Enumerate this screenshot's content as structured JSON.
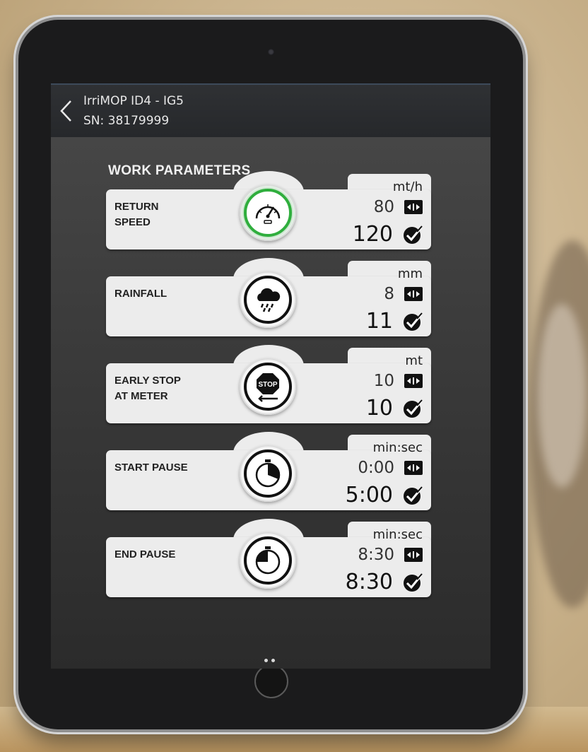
{
  "header": {
    "device_name": "IrriMOP ID4 - IG5",
    "serial": "SN: 38179999"
  },
  "section_title": "WORK PARAMETERS",
  "params": [
    {
      "label": "RETURN\nSPEED",
      "unit": "mt/h",
      "current": "80",
      "set": "120",
      "icon": "speedometer-icon",
      "active": true
    },
    {
      "label": "RAINFALL",
      "unit": "mm",
      "current": "8",
      "set": "11",
      "icon": "rain-cloud-icon",
      "active": false
    },
    {
      "label": "EARLY STOP\nAT METER",
      "unit": "mt",
      "current": "10",
      "set": "10",
      "icon": "stop-sign-icon",
      "active": false
    },
    {
      "label": "START PAUSE",
      "unit": "min:sec",
      "current": "0:00",
      "set": "5:00",
      "icon": "timer-start-icon",
      "active": false
    },
    {
      "label": "END PAUSE",
      "unit": "min:sec",
      "current": "8:30",
      "set": "8:30",
      "icon": "timer-end-icon",
      "active": false
    }
  ],
  "colors": {
    "active_ring": "#2fae3d",
    "card_bg": "#ececec",
    "screen_bg": "#3c3c3c"
  },
  "pagination": {
    "pages": 2
  }
}
